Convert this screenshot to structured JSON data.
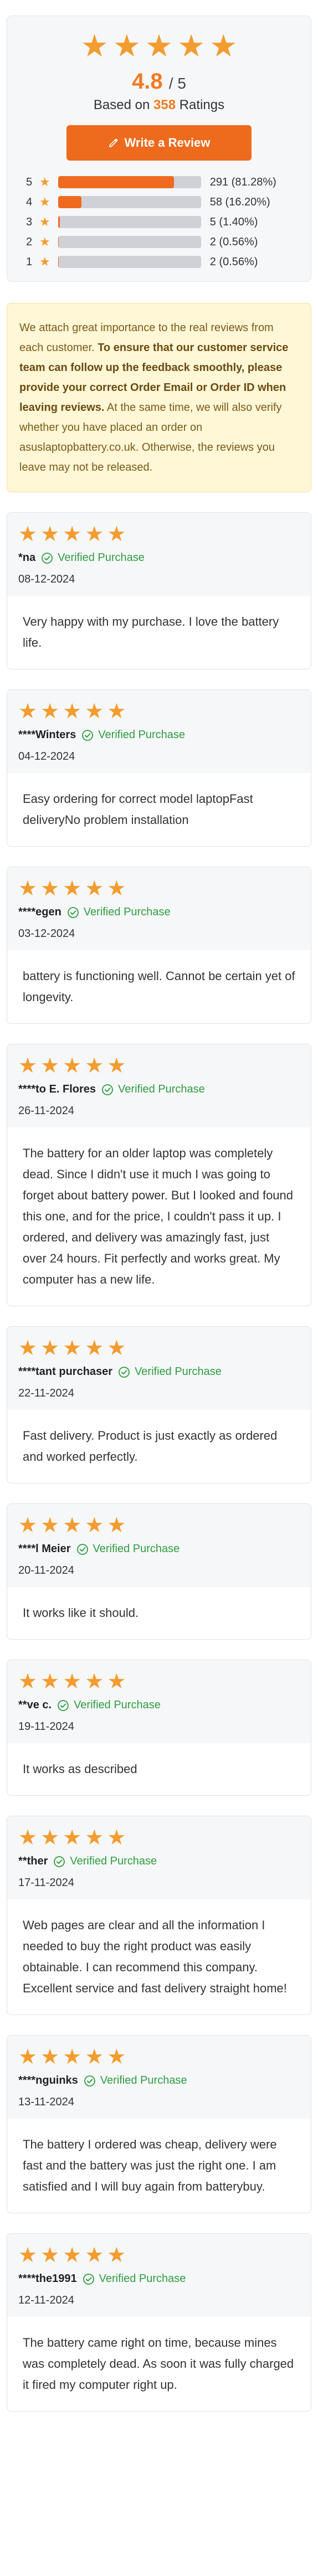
{
  "summary": {
    "average": "4.8",
    "scale": "/ 5",
    "based_prefix": "Based on",
    "count": "358",
    "based_suffix": "Ratings",
    "write_button": "Write a Review",
    "distribution": [
      {
        "stars": "5",
        "count_label": "291 (81.28%)",
        "percent": 81.28
      },
      {
        "stars": "4",
        "count_label": "58 (16.20%)",
        "percent": 16.2
      },
      {
        "stars": "3",
        "count_label": "5 (1.40%)",
        "percent": 1.4
      },
      {
        "stars": "2",
        "count_label": "2 (0.56%)",
        "percent": 0.56
      },
      {
        "stars": "1",
        "count_label": "2 (0.56%)",
        "percent": 0.56
      }
    ]
  },
  "notice": {
    "part1": "We attach great importance to the real reviews from each customer. ",
    "part2_bold": "To ensure that our customer service team can follow up the feedback smoothly, please provide your correct Order Email or Order ID when leaving reviews.",
    "part3": " At the same time, we will also verify whether you have placed an order on asuslaptopbattery.co.uk. Otherwise, the reviews you leave may not be released."
  },
  "verified_label": "Verified Purchase",
  "reviews": [
    {
      "author": "*na",
      "date": "08-12-2024",
      "rating": 5,
      "text": "Very happy with my purchase. I love the battery life."
    },
    {
      "author": "****Winters",
      "date": "04-12-2024",
      "rating": 5,
      "text": "Easy ordering for correct model laptopFast deliveryNo problem installation"
    },
    {
      "author": "****egen",
      "date": "03-12-2024",
      "rating": 5,
      "text": "battery is functioning well. Cannot be certain yet of longevity."
    },
    {
      "author": "****to E. Flores",
      "date": "26-11-2024",
      "rating": 5,
      "text": "The battery for an older laptop was completely dead. Since I didn't use it much I was going to forget about battery power. But I looked and found this one, and for the price, I couldn't pass it up. I ordered, and delivery was amazingly fast, just over 24 hours. Fit perfectly and works great. My computer has a new life."
    },
    {
      "author": "****tant purchaser",
      "date": "22-11-2024",
      "rating": 5,
      "text": "Fast delivery. Product is just exactly as ordered and worked perfectly."
    },
    {
      "author": "****l Meier",
      "date": "20-11-2024",
      "rating": 5,
      "text": "It works like it should."
    },
    {
      "author": "**ve c.",
      "date": "19-11-2024",
      "rating": 5,
      "text": "It works as described"
    },
    {
      "author": "**ther",
      "date": "17-11-2024",
      "rating": 5,
      "text": "Web pages are clear and all the information I needed to buy the right product was easily obtainable. I can recommend this company. Excellent service and fast delivery straight home!"
    },
    {
      "author": "****nguinks",
      "date": "13-11-2024",
      "rating": 5,
      "text": "The battery I ordered was cheap, delivery were fast and the battery was just the right one. I am satisfied and I will buy again from batterybuy."
    },
    {
      "author": "****the1991",
      "date": "12-11-2024",
      "rating": 5,
      "text": "The battery came right on time, because mines was completely dead. As soon it was fully charged it fired my computer right up."
    }
  ],
  "colors": {
    "accent": "#ef7b21",
    "star": "#f39c2f",
    "verified": "#2e9d3f",
    "notice_bg": "#fff7d6"
  },
  "icons": {
    "star": "star-icon",
    "pencil": "pencil-icon",
    "check": "check-circle-icon"
  }
}
